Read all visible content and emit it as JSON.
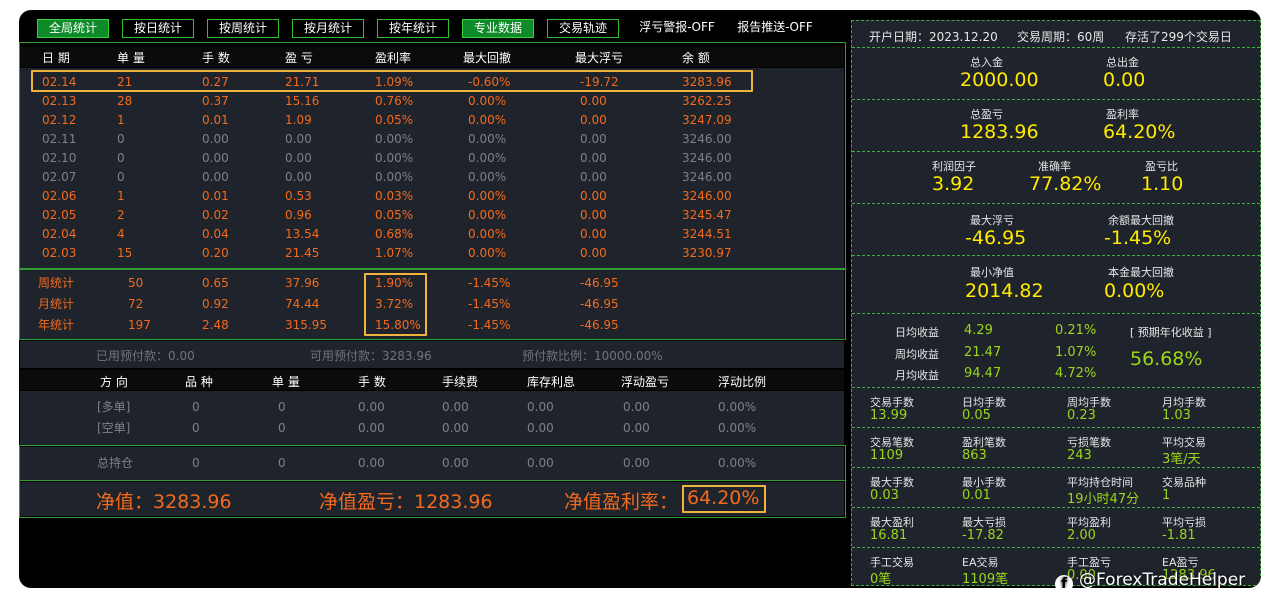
{
  "toolbar": {
    "buttons": [
      "全局统计",
      "按日统计",
      "按周统计",
      "按月统计",
      "按年统计",
      "专业数据",
      "交易轨迹"
    ],
    "float_alert": "浮亏警报-OFF",
    "report_push": "报告推送-OFF"
  },
  "daily_table": {
    "headers": [
      "日 期",
      "单 量",
      "手 数",
      "盈 亏",
      "盈利率",
      "最大回撤",
      "最大浮亏",
      "余 额"
    ],
    "rows": [
      [
        "02.14",
        "21",
        "0.27",
        "21.71",
        "1.09%",
        "-0.60%",
        "-19.72",
        "3283.96"
      ],
      [
        "02.13",
        "28",
        "0.37",
        "15.16",
        "0.76%",
        "0.00%",
        "0.00",
        "3262.25"
      ],
      [
        "02.12",
        "1",
        "0.01",
        "1.09",
        "0.05%",
        "0.00%",
        "0.00",
        "3247.09"
      ],
      [
        "02.11",
        "0",
        "0.00",
        "0.00",
        "0.00%",
        "0.00%",
        "0.00",
        "3246.00"
      ],
      [
        "02.10",
        "0",
        "0.00",
        "0.00",
        "0.00%",
        "0.00%",
        "0.00",
        "3246.00"
      ],
      [
        "02.07",
        "0",
        "0.00",
        "0.00",
        "0.00%",
        "0.00%",
        "0.00",
        "3246.00"
      ],
      [
        "02.06",
        "1",
        "0.01",
        "0.53",
        "0.03%",
        "0.00%",
        "0.00",
        "3246.00"
      ],
      [
        "02.05",
        "2",
        "0.02",
        "0.96",
        "0.05%",
        "0.00%",
        "0.00",
        "3245.47"
      ],
      [
        "02.04",
        "4",
        "0.04",
        "13.54",
        "0.68%",
        "0.00%",
        "0.00",
        "3244.51"
      ],
      [
        "02.03",
        "15",
        "0.20",
        "21.45",
        "1.07%",
        "0.00%",
        "0.00",
        "3230.97"
      ]
    ]
  },
  "period_stats": [
    [
      "周统计",
      "50",
      "0.65",
      "37.96",
      "1.90%",
      "-1.45%",
      "-46.95"
    ],
    [
      "月统计",
      "72",
      "0.92",
      "74.44",
      "3.72%",
      "-1.45%",
      "-46.95"
    ],
    [
      "年统计",
      "197",
      "2.48",
      "315.95",
      "15.80%",
      "-1.45%",
      "-46.95"
    ]
  ],
  "prepay": {
    "used": "已用预付款：0.00",
    "available": "可用预付款：3283.96",
    "ratio": "预付款比例：10000.00%"
  },
  "positions": {
    "headers": [
      "方 向",
      "品 种",
      "单 量",
      "手 数",
      "手续费",
      "库存利息",
      "浮动盈亏",
      "浮动比例"
    ],
    "rows": [
      [
        "[多单]",
        "0",
        "0",
        "0.00",
        "0.00",
        "0.00",
        "0.00",
        "0.00%"
      ],
      [
        "[空单]",
        "0",
        "0",
        "0.00",
        "0.00",
        "0.00",
        "0.00",
        "0.00%"
      ]
    ],
    "total": [
      "总持仓",
      "0",
      "0",
      "0.00",
      "0.00",
      "0.00",
      "0.00",
      "0.00%"
    ]
  },
  "summary": {
    "equity": "净值：3283.96",
    "equity_pl": "净值盈亏：1283.96",
    "equity_rate_label": "净值盈利率：",
    "equity_rate_value": "64.20%"
  },
  "right": {
    "info": {
      "open_date": "开户日期：2023.12.20",
      "period": "交易周期：60周",
      "alive": "存活了299个交易日"
    },
    "deposit": {
      "label": "总入金",
      "value": "2000.00"
    },
    "withdraw": {
      "label": "总出金",
      "value": "0.00"
    },
    "total_pl": {
      "label": "总盈亏",
      "value": "1283.96"
    },
    "profit_rate": {
      "label": "盈利率",
      "value": "64.20%"
    },
    "profit_factor": {
      "label": "利润因子",
      "value": "3.92"
    },
    "accuracy": {
      "label": "准确率",
      "value": "77.82%"
    },
    "pl_ratio": {
      "label": "盈亏比",
      "value": "1.10"
    },
    "max_float": {
      "label": "最大浮亏",
      "value": "-46.95"
    },
    "balance_dd": {
      "label": "余额最大回撤",
      "value": "-1.45%"
    },
    "min_equity": {
      "label": "最小净值",
      "value": "2014.82"
    },
    "capital_dd": {
      "label": "本金最大回撤",
      "value": "0.00%"
    },
    "avg_income": [
      {
        "label": "日均收益",
        "value": "4.29",
        "rate": "0.21%"
      },
      {
        "label": "周均收益",
        "value": "21.47",
        "rate": "1.07%"
      },
      {
        "label": "月均收益",
        "value": "94.47",
        "rate": "4.72%"
      }
    ],
    "annual": {
      "label": "[ 预期年化收益 ]",
      "value": "56.68%"
    },
    "grid": [
      [
        {
          "label": "交易手数",
          "value": "13.99"
        },
        {
          "label": "日均手数",
          "value": "0.05"
        },
        {
          "label": "周均手数",
          "value": "0.23"
        },
        {
          "label": "月均手数",
          "value": "1.03"
        }
      ],
      [
        {
          "label": "交易笔数",
          "value": "1109"
        },
        {
          "label": "盈利笔数",
          "value": "863"
        },
        {
          "label": "亏损笔数",
          "value": "243"
        },
        {
          "label": "平均交易",
          "value": "3笔/天"
        }
      ],
      [
        {
          "label": "最大手数",
          "value": "0.03"
        },
        {
          "label": "最小手数",
          "value": "0.01"
        },
        {
          "label": "平均持仓时间",
          "value": "19小时47分"
        },
        {
          "label": "交易品种",
          "value": "1"
        }
      ],
      [
        {
          "label": "最大盈利",
          "value": "16.81"
        },
        {
          "label": "最大亏损",
          "value": "-17.82"
        },
        {
          "label": "平均盈利",
          "value": "2.00"
        },
        {
          "label": "平均亏损",
          "value": "-1.81"
        }
      ],
      [
        {
          "label": "手工交易",
          "value": "0笔"
        },
        {
          "label": "EA交易",
          "value": "1109笔"
        },
        {
          "label": "手工盈亏",
          "value": "0.00"
        },
        {
          "label": "EA盈亏",
          "value": "1283.96"
        }
      ]
    ]
  },
  "watermark": {
    "icon": "f",
    "text": "@ForexTradeHelper"
  }
}
